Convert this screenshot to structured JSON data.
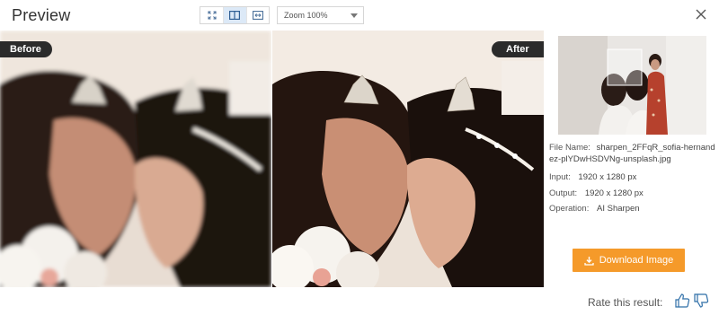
{
  "header": {
    "title": "Preview",
    "zoom_value": "Zoom  100%",
    "view_modes": [
      "fit-screen",
      "split-view",
      "compare-slider"
    ],
    "active_view": "split-view"
  },
  "labels": {
    "before": "Before",
    "after": "After"
  },
  "file_info": {
    "file_name_label": "File Name:",
    "file_name_value": "sharpen_2FFqR_sofia-hernandez-plYDwHSDVNg-unsplash.jpg",
    "input_label": "Input:",
    "input_value": "1920 x 1280 px",
    "output_label": "Output:",
    "output_value": "1920 x 1280 px",
    "operation_label": "Operation:",
    "operation_value": "AI Sharpen"
  },
  "actions": {
    "download_label": "Download Image"
  },
  "footer": {
    "rate_label": "Rate this result:"
  },
  "colors": {
    "accent_orange": "#f59a2a",
    "tag_dark": "#2b2b2b",
    "active_view_bg": "#dce9f7"
  },
  "icons": [
    "fullscreen-icon",
    "split-view-icon",
    "compare-icon",
    "close-icon",
    "download-icon",
    "thumbs-up-icon",
    "thumbs-down-icon"
  ]
}
